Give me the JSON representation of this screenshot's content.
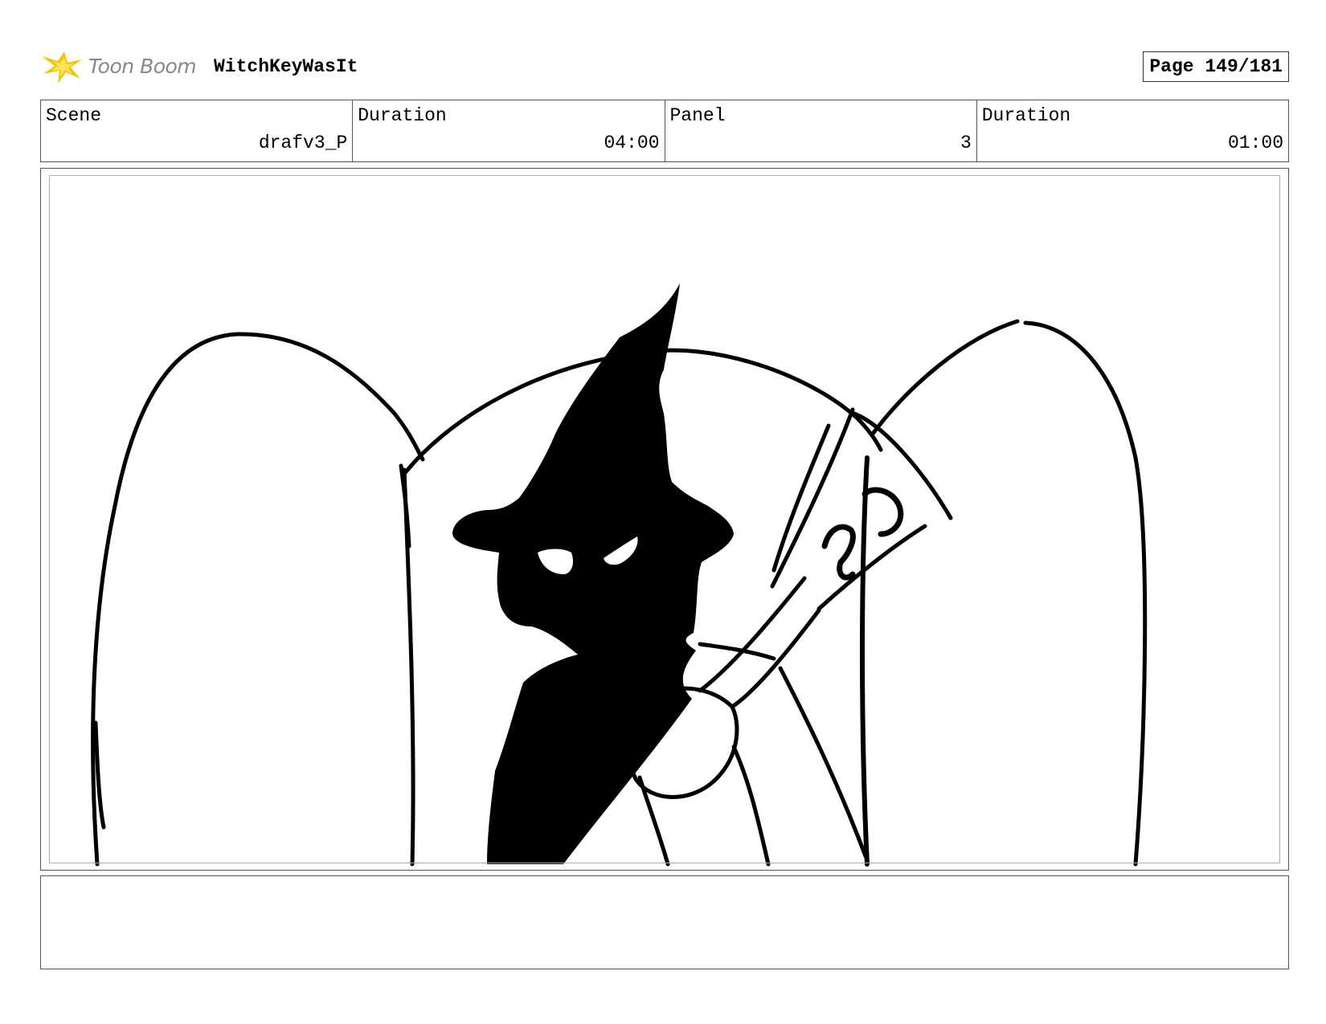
{
  "header": {
    "logo_text": "Toon Boom",
    "project_title": "WitchKeyWasIt",
    "page_label": "Page 149/181"
  },
  "info": {
    "scene_label": "Scene",
    "scene_value": "drafv3_P",
    "scene_duration_label": "Duration",
    "scene_duration_value": "04:00",
    "panel_label": "Panel",
    "panel_value": "3",
    "panel_duration_label": "Duration",
    "panel_duration_value": "01:00"
  },
  "panel": {
    "description": ""
  },
  "notes": {
    "text": ""
  },
  "colors": {
    "logo_accent": "#f5c400",
    "logo_text": "#888888",
    "ink": "#000000"
  }
}
